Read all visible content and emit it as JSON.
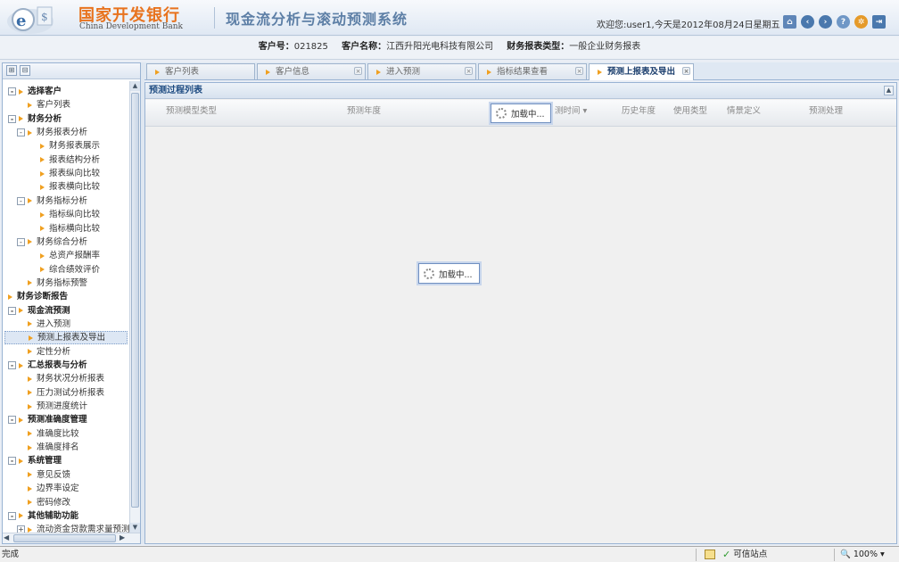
{
  "header": {
    "logo_cn": "国家开发银行",
    "logo_en": "China Development Bank",
    "system_title": "现金流分析与滚动预测系统",
    "welcome": "欢迎您:user1,今天是2012年08月24日星期五",
    "icons": [
      "home-icon",
      "back-icon",
      "forward-icon",
      "help-icon",
      "settings-icon",
      "logout-icon"
    ]
  },
  "infobar": {
    "customer_no_label": "客户号：",
    "customer_no": "021825",
    "customer_name_label": "客户名称：",
    "customer_name": "江西升阳光电科技有限公司",
    "report_type_label": "财务报表类型：",
    "report_type": "一般企业财务报表"
  },
  "sidebar": {
    "tree": [
      {
        "label": "选择客户",
        "level": 0,
        "bold": true,
        "expander": "-"
      },
      {
        "label": "客户列表",
        "level": 1
      },
      {
        "label": "财务分析",
        "level": 0,
        "bold": true,
        "expander": "-"
      },
      {
        "label": "财务报表分析",
        "level": 1,
        "expander": "-"
      },
      {
        "label": "财务报表展示",
        "level": 2
      },
      {
        "label": "报表结构分析",
        "level": 2
      },
      {
        "label": "报表纵向比较",
        "level": 2
      },
      {
        "label": "报表横向比较",
        "level": 2
      },
      {
        "label": "财务指标分析",
        "level": 1,
        "expander": "-"
      },
      {
        "label": "指标纵向比较",
        "level": 2
      },
      {
        "label": "指标横向比较",
        "level": 2
      },
      {
        "label": "财务综合分析",
        "level": 1,
        "expander": "-"
      },
      {
        "label": "总资产报酬率",
        "level": 2
      },
      {
        "label": "综合绩效评价",
        "level": 2
      },
      {
        "label": "财务指标预警",
        "level": 1
      },
      {
        "label": "财务诊断报告",
        "level": 0,
        "bold": true
      },
      {
        "label": "现金流预测",
        "level": 0,
        "bold": true,
        "expander": "-"
      },
      {
        "label": "进入预测",
        "level": 1
      },
      {
        "label": "预测上报表及导出",
        "level": 1,
        "selected": true
      },
      {
        "label": "定性分析",
        "level": 1
      },
      {
        "label": "汇总报表与分析",
        "level": 0,
        "bold": true,
        "expander": "-"
      },
      {
        "label": "财务状况分析报表",
        "level": 1
      },
      {
        "label": "压力测试分析报表",
        "level": 1
      },
      {
        "label": "预测进度统计",
        "level": 1
      },
      {
        "label": "预测准确度管理",
        "level": 0,
        "bold": true,
        "expander": "-"
      },
      {
        "label": "准确度比较",
        "level": 1
      },
      {
        "label": "准确度排名",
        "level": 1
      },
      {
        "label": "系统管理",
        "level": 0,
        "bold": true,
        "expander": "-"
      },
      {
        "label": "意见反馈",
        "level": 1
      },
      {
        "label": "边界率设定",
        "level": 1
      },
      {
        "label": "密码修改",
        "level": 1
      },
      {
        "label": "其他辅助功能",
        "level": 0,
        "bold": true,
        "expander": "-"
      },
      {
        "label": "流动资金贷款需求量预测",
        "level": 1,
        "expander": "+"
      }
    ]
  },
  "tabs": [
    {
      "label": "客户列表",
      "closable": false
    },
    {
      "label": "客户信息",
      "closable": true
    },
    {
      "label": "进入预测",
      "closable": true
    },
    {
      "label": "指标结果查看",
      "closable": true
    },
    {
      "label": "预测上报表及导出",
      "closable": true,
      "active": true
    }
  ],
  "panel": {
    "title": "预测过程列表",
    "columns": [
      "预测模型类型",
      "预测年度",
      "测时间",
      "历史年度",
      "使用类型",
      "情景定义",
      "预测处理"
    ],
    "sort_indicator": "▾"
  },
  "loading": {
    "header_text": "加载中...",
    "center_text": "加载中..."
  },
  "statusbar": {
    "status": "完成",
    "zone": "可信站点",
    "zoom": "100%"
  },
  "colors": {
    "accent": "#1f4c82",
    "logo_orange": "#e8731e",
    "tree_arrow": "#f0a020"
  }
}
